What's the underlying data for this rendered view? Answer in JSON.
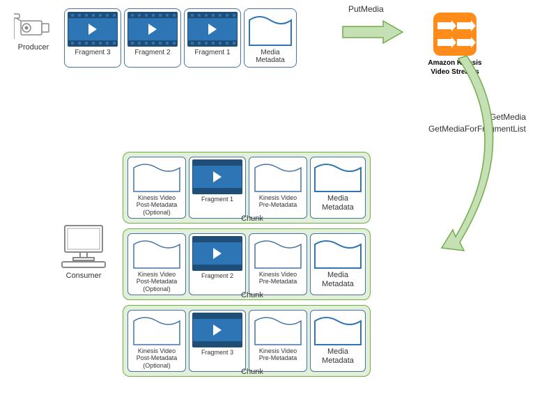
{
  "producer": {
    "label": "Producer"
  },
  "consumer": {
    "label": "Consumer"
  },
  "api": {
    "put": "PutMedia",
    "get_line1": "GetMedia",
    "get_line2": "GetMediaForFragmentList"
  },
  "kinesis": {
    "name_line1": "Amazon Kinesis",
    "name_line2": "Video Streams"
  },
  "top_row": {
    "fragments": [
      {
        "label": "Fragment 3"
      },
      {
        "label": "Fragment 2"
      },
      {
        "label": "Fragment 1"
      }
    ],
    "media_meta_line1": "Media",
    "media_meta_line2": "Metadata"
  },
  "chunk_common": {
    "post_meta_line1": "Kinesis Video",
    "post_meta_line2": "Post-Metadata",
    "post_meta_line3": "(Optional)",
    "pre_meta_line1": "Kinesis Video",
    "pre_meta_line2": "Pre-Metadata",
    "media_meta_line1": "Media",
    "media_meta_line2": "Metadata",
    "chunk_label": "Chunk"
  },
  "chunks": [
    {
      "fragment_label": "Fragment 1"
    },
    {
      "fragment_label": "Fragment 2"
    },
    {
      "fragment_label": "Fragment 3"
    }
  ]
}
